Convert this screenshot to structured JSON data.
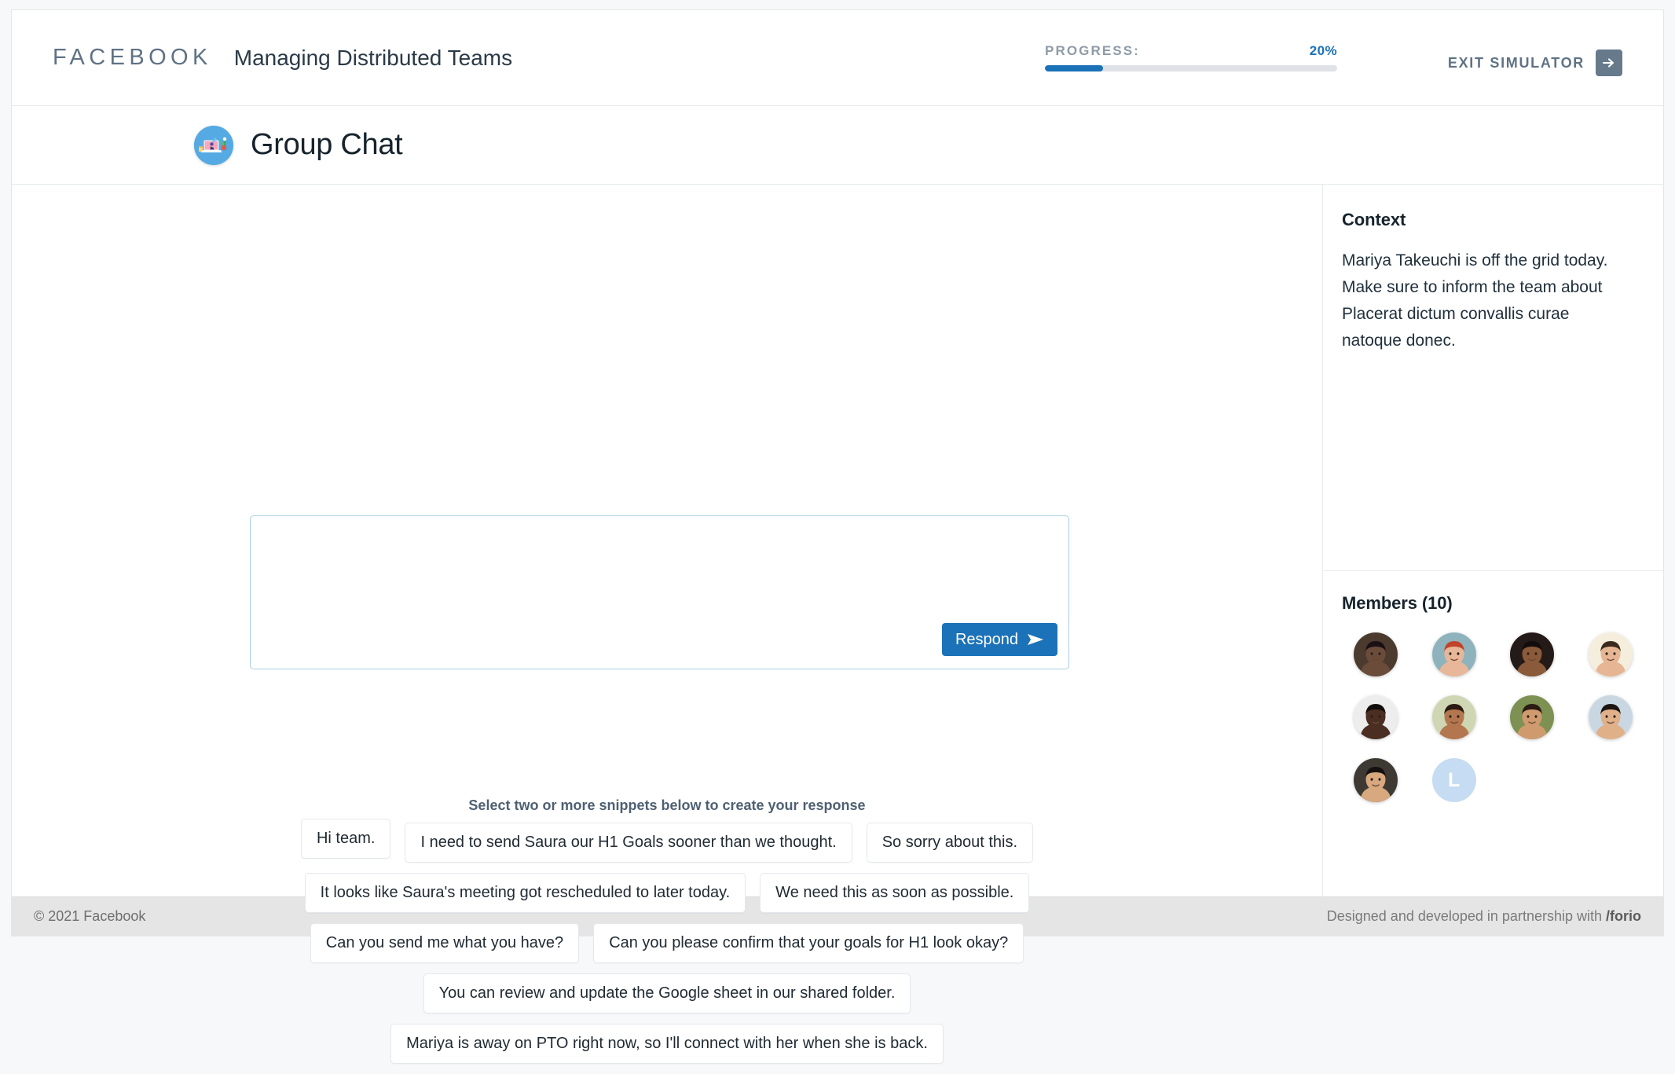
{
  "topbar": {
    "brand": "FACEBOOK",
    "course_title": "Managing Distributed Teams",
    "progress_label": "PROGRESS:",
    "progress_percent": "20%",
    "progress_value": 20,
    "exit_label": "EXIT SIMULATOR",
    "exit_icon": "arrow-right-icon",
    "accent_color": "#1b72b8",
    "brand_color": "#5f7285"
  },
  "section": {
    "title": "Group Chat",
    "avatar_icon": "laptop-workspace-icon"
  },
  "compose": {
    "value": "",
    "placeholder": "",
    "respond_label": "Respond",
    "respond_icon": "send-icon"
  },
  "snippets": {
    "hint": "Select two or more snippets below to create your response",
    "rows": [
      [
        "Hi team.",
        "I need to send Saura our H1 Goals sooner than we thought.",
        "So sorry about this."
      ],
      [
        "It looks like Saura's meeting got rescheduled to later today.",
        "We need this as soon as possible."
      ],
      [
        "Can you send me what you have?",
        "Can you please confirm that your goals for H1 look okay?"
      ],
      [
        "You can review and update the Google sheet in our shared folder."
      ],
      [
        "Mariya is away on PTO right now, so I'll connect with her when she is back."
      ]
    ]
  },
  "context": {
    "heading": "Context",
    "text": "Mariya  Takeuchi is off the grid today. Make sure to inform the team about Placerat dictum convallis curae natoque donec."
  },
  "members": {
    "heading": "Members (10)",
    "count": 10,
    "people": [
      {
        "type": "photo",
        "name": "member-avatar-1",
        "skin": "#6b4c3b",
        "hair": "#1a1013",
        "bg": "#4b3a2e"
      },
      {
        "type": "photo",
        "name": "member-avatar-2",
        "skin": "#e8b79a",
        "hair": "#c0432a",
        "bg": "#8fb3bd"
      },
      {
        "type": "photo",
        "name": "member-avatar-3",
        "skin": "#8a5a3b",
        "hair": "#120d0c",
        "bg": "#241a17"
      },
      {
        "type": "photo",
        "name": "member-avatar-4",
        "skin": "#e6b694",
        "hair": "#3b2a1d",
        "bg": "#f6eedc"
      },
      {
        "type": "photo",
        "name": "member-avatar-5",
        "skin": "#4a2e22",
        "hair": "#120c0a",
        "bg": "#ededee"
      },
      {
        "type": "photo",
        "name": "member-avatar-6",
        "skin": "#b3764e",
        "hair": "#2b1a12",
        "bg": "#cfd6b4"
      },
      {
        "type": "photo",
        "name": "member-avatar-7",
        "skin": "#cf9a6e",
        "hair": "#2a1c13",
        "bg": "#7c9152"
      },
      {
        "type": "photo",
        "name": "member-avatar-8",
        "skin": "#e0b089",
        "hair": "#1b1411",
        "bg": "#c9d7e2"
      },
      {
        "type": "photo",
        "name": "member-avatar-9",
        "skin": "#d8a87f",
        "hair": "#161110",
        "bg": "#3e3a33"
      },
      {
        "type": "initial",
        "name": "member-avatar-10",
        "letter": "L",
        "bg": "#c5dcf2"
      }
    ]
  },
  "footer": {
    "left": "© 2021 Facebook",
    "right_prefix": "Designed and developed in partnership with ",
    "right_brand": "/forio"
  }
}
